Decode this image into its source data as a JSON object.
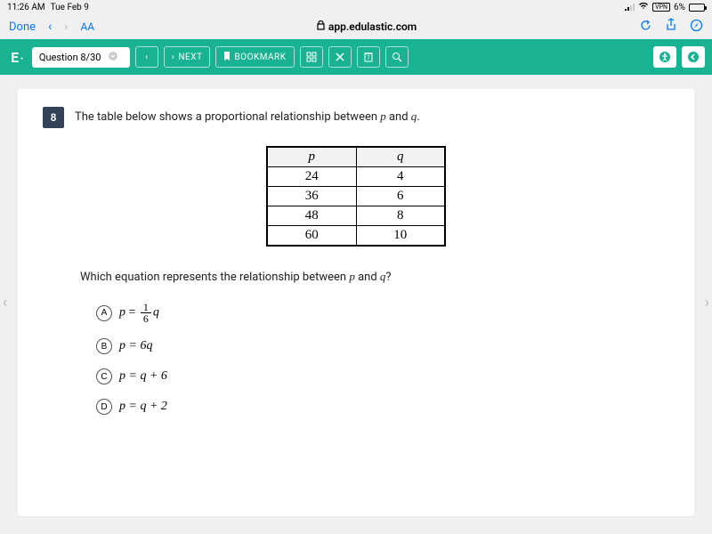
{
  "status": {
    "time": "11:26 AM",
    "date": "Tue Feb 9",
    "vpn": "VPN",
    "battery_pct": "6%"
  },
  "browser": {
    "done": "Done",
    "aa": "AA",
    "url": "app.edulastic.com"
  },
  "appbar": {
    "logo": "E",
    "question_label": "Question 8/30",
    "next": "NEXT",
    "bookmark": "BOOKMARK"
  },
  "question": {
    "number": "8",
    "prompt_pre": "The table below shows a proportional relationship between ",
    "prompt_var1": "p",
    "prompt_mid": " and ",
    "prompt_var2": "q",
    "prompt_post": ".",
    "sub_pre": "Which equation represents the relationship between ",
    "sub_var1": "p",
    "sub_mid": " and ",
    "sub_var2": "q",
    "sub_post": "?"
  },
  "table": {
    "head_p": "p",
    "head_q": "q",
    "rows": [
      {
        "p": "24",
        "q": "4"
      },
      {
        "p": "36",
        "q": "6"
      },
      {
        "p": "48",
        "q": "8"
      },
      {
        "p": "60",
        "q": "10"
      }
    ]
  },
  "options": {
    "a_letter": "A",
    "a_var": "p",
    "a_eq": " = ",
    "a_num": "1",
    "a_den": "6",
    "a_tail": "q",
    "b_letter": "B",
    "b_text_var": "p",
    "b_text_rest": " = 6q",
    "c_letter": "C",
    "c_text_var": "p",
    "c_text_rest": " = q + 6",
    "d_letter": "D",
    "d_text_var": "p",
    "d_text_rest": " = q + 2"
  }
}
